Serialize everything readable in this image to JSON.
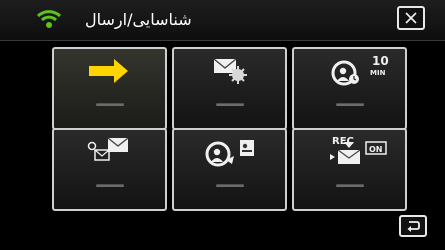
{
  "header": {
    "title": "شناسایی/ارسال",
    "wifi_color": "#5fc31f"
  },
  "tiles": [
    {
      "id": "tile-start-wireless",
      "label": "▬▬▬▬▬▬",
      "icon": "yellow-right-arrow-icon",
      "accent": "#ffd400"
    },
    {
      "id": "tile-email-settings",
      "label": "▬▬▬▬▬▬",
      "icon": "mail-gear-icon"
    },
    {
      "id": "tile-interval-recording",
      "label": "▬▬▬▬▬▬",
      "icon": "camera-10-min-icon",
      "badge": [
        "10",
        "MIN"
      ]
    },
    {
      "id": "tile-send-email",
      "label": "▬▬▬▬▬▬",
      "icon": "send-mail-icon"
    },
    {
      "id": "tile-address-book",
      "label": "▬▬▬▬▬▬",
      "icon": "camera-contact-icon"
    },
    {
      "id": "tile-rec-email",
      "label": "▬▬▬▬▬▬",
      "icon": "rec-on-icon",
      "rec_text": "REC",
      "on_text": "ON"
    }
  ]
}
